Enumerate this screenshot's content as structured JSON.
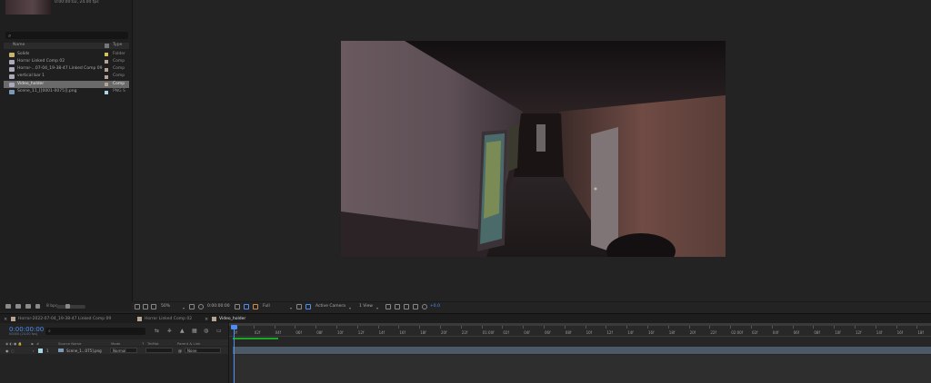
{
  "project": {
    "thumb_info": "0:00:00:02, 24.00 fps",
    "search_placeholder": "",
    "columns": {
      "name": "Name",
      "type": "Type"
    },
    "items": [
      {
        "name": "Solids",
        "type": "Folder",
        "kind": "folder",
        "color": "#d6c257"
      },
      {
        "name": "Horror Linked Comp 02",
        "type": "Comp",
        "kind": "comp",
        "color": "#b9a58f"
      },
      {
        "name": "Horror-...07-04_19-38-47 Linked Comp 09",
        "type": "Comp",
        "kind": "comp",
        "color": "#b9a58f"
      },
      {
        "name": "vertical bar 1",
        "type": "Comp",
        "kind": "comp",
        "color": "#b9a58f"
      },
      {
        "name": "Video_holder",
        "type": "Comp",
        "kind": "comp",
        "color": "#b9a58f",
        "selected": true
      },
      {
        "name": "Scene_11_[[0001-0075]].png",
        "type": "PNG S",
        "kind": "png",
        "color": "#a8d7e3"
      }
    ],
    "bpc": "8 bpc"
  },
  "viewer_toolbar": {
    "zoom": "50%",
    "timecode": "0:00:00:00",
    "resolution": "Full",
    "camera": "Active Camera",
    "views": "1 View",
    "exposure": "+0.0"
  },
  "timeline": {
    "tabs": [
      {
        "label": "Horror-2022-07-04_19-38-47 Linked Comp 09",
        "color": "#b9a58f"
      },
      {
        "label": "Horror Linked Comp 02",
        "color": "#b9a58f"
      },
      {
        "label": "Video_holder",
        "color": "#b9a58f",
        "active": true
      }
    ],
    "timecode": "0:00:00:00",
    "timecode_sub": "00000 (24.00 fps)",
    "columns": {
      "source_name": "Source Name",
      "mode": "Mode",
      "t": "T",
      "trkmat": "TrkMat",
      "parent": "Parent & Link"
    },
    "layer": {
      "index": "1",
      "name": "Scene_1...075].png",
      "mode": "Normal",
      "parent": "None"
    },
    "ruler": [
      "0f",
      "02f",
      "04f",
      "06f",
      "08f",
      "10f",
      "12f",
      "14f",
      "16f",
      "18f",
      "20f",
      "22f",
      "01:00f",
      "02f",
      "04f",
      "06f",
      "08f",
      "10f",
      "12f",
      "14f",
      "16f",
      "18f",
      "20f",
      "22f",
      "02:00f",
      "02f",
      "04f",
      "06f",
      "08f",
      "10f",
      "12f",
      "14f",
      "16f",
      "18f",
      "20f"
    ],
    "accent": "#4d8ef5"
  }
}
